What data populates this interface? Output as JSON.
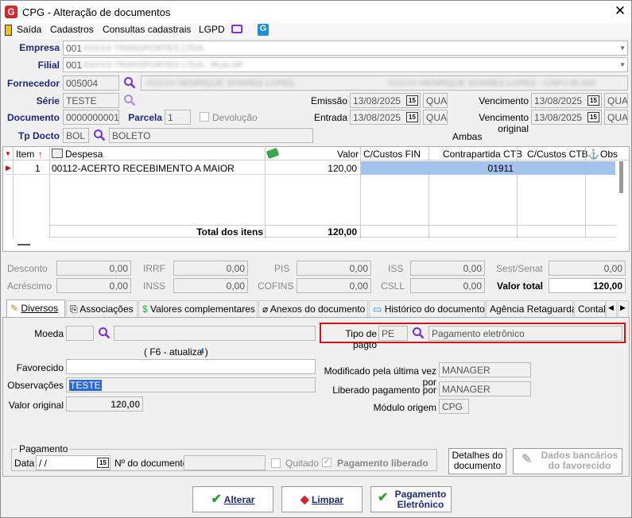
{
  "window": {
    "title": "CPG - Alteração de documentos",
    "close": "✕"
  },
  "menu": [
    "Saída",
    "Cadastros",
    "Consultas cadastrais",
    "LGPD"
  ],
  "labels": {
    "empresa": "Empresa",
    "filial": "Filial",
    "fornecedor": "Fornecedor",
    "serie": "Série",
    "documento": "Documento",
    "parcela": "Parcela",
    "devolucao": "Devolução",
    "tp_docto": "Tp Docto",
    "emissao": "Emissão",
    "entrada": "Entrada",
    "vencimento": "Vencimento",
    "vencimento_original": "Vencimento original",
    "ambas": "Ambas"
  },
  "header": {
    "empresa": "001",
    "filial": "001",
    "fornecedor": "005004",
    "serie": "TESTE",
    "documento": "0000000001",
    "parcela": "1",
    "tp_docto": "BOL",
    "tp_docto_desc": "BOLETO",
    "emissao": "13/08/2025",
    "emissao_dia": "QUA",
    "entrada": "13/08/2025",
    "entrada_dia": "QUA",
    "vencimento": "13/08/2025",
    "vencimento_dia": "QUA",
    "vencimento_original": "13/08/2025",
    "vencimento_original_dia": "QUA",
    "empresa_blur": "XXXXX TRANSPORTES LTDA",
    "filial_blur": "XXXXX TRANSPORTES LTDA - RUA SP",
    "fornecedor_blur1": "XXXXX HENRIQUE SOARES LOPES",
    "fornecedor_blur2": "XXXXX HENRIQUE SOARES LOPES - CNPJ 00.000"
  },
  "grid": {
    "columns": [
      "Item",
      "Despesa",
      "Valor",
      "C/Custos FIN",
      "Contrapartida CTB",
      "C/Custos CTB",
      "Obs"
    ],
    "rows": [
      {
        "item": "1",
        "despesa": "00112-ACERTO RECEBIMENTO A MAIOR",
        "valor": "120,00",
        "contrapartida": "01911"
      }
    ],
    "total_label": "Total dos itens",
    "total": "120,00"
  },
  "taxes": {
    "desconto": "Desconto",
    "acrescimo": "Acréscimo",
    "irrf": "IRRF",
    "inss": "INSS",
    "pis": "PIS",
    "cofins": "COFINS",
    "iss": "ISS",
    "csll": "CSLL",
    "sest": "Sest/Senat",
    "valor_total": "Valor total",
    "zero": "0,00",
    "total": "120,00"
  },
  "tabs": [
    "Diversos",
    "Associações",
    "Valores complementares",
    "Anexos do documento",
    "Histórico do documento",
    "Agência Retaguarda",
    "Contal"
  ],
  "diversos": {
    "moeda": "Moeda",
    "f6": "( F6 - atualiza )",
    "favorecido": "Favorecido",
    "observacoes": "Observações",
    "obs_value": "TESTE",
    "valor_original": "Valor original",
    "valor_original_value": "120,00",
    "tipo_pagto": "Tipo de pagto",
    "tipo_pagto_code": "PE",
    "tipo_pagto_desc": "Pagamento eletrônico",
    "modificado": "Modificado pela última vez por",
    "modificado_value": "MANAGER",
    "liberado": "Liberado pagamento por",
    "liberado_value": "MANAGER",
    "modulo": "Módulo origem",
    "modulo_value": "CPG",
    "pagamento": "Pagamento",
    "data": "Data",
    "data_value": " /  /",
    "nro_doc": "Nº do documento",
    "quitado": "Quitado",
    "pag_liberado": "Pagamento liberado",
    "detalhes": "Detalhes do documento",
    "dados_bancarios": "Dados bancários do favorecido"
  },
  "buttons": {
    "alterar": "Alterar",
    "limpar": "Limpar",
    "pagamento": "Pagamento Eletrônico"
  }
}
